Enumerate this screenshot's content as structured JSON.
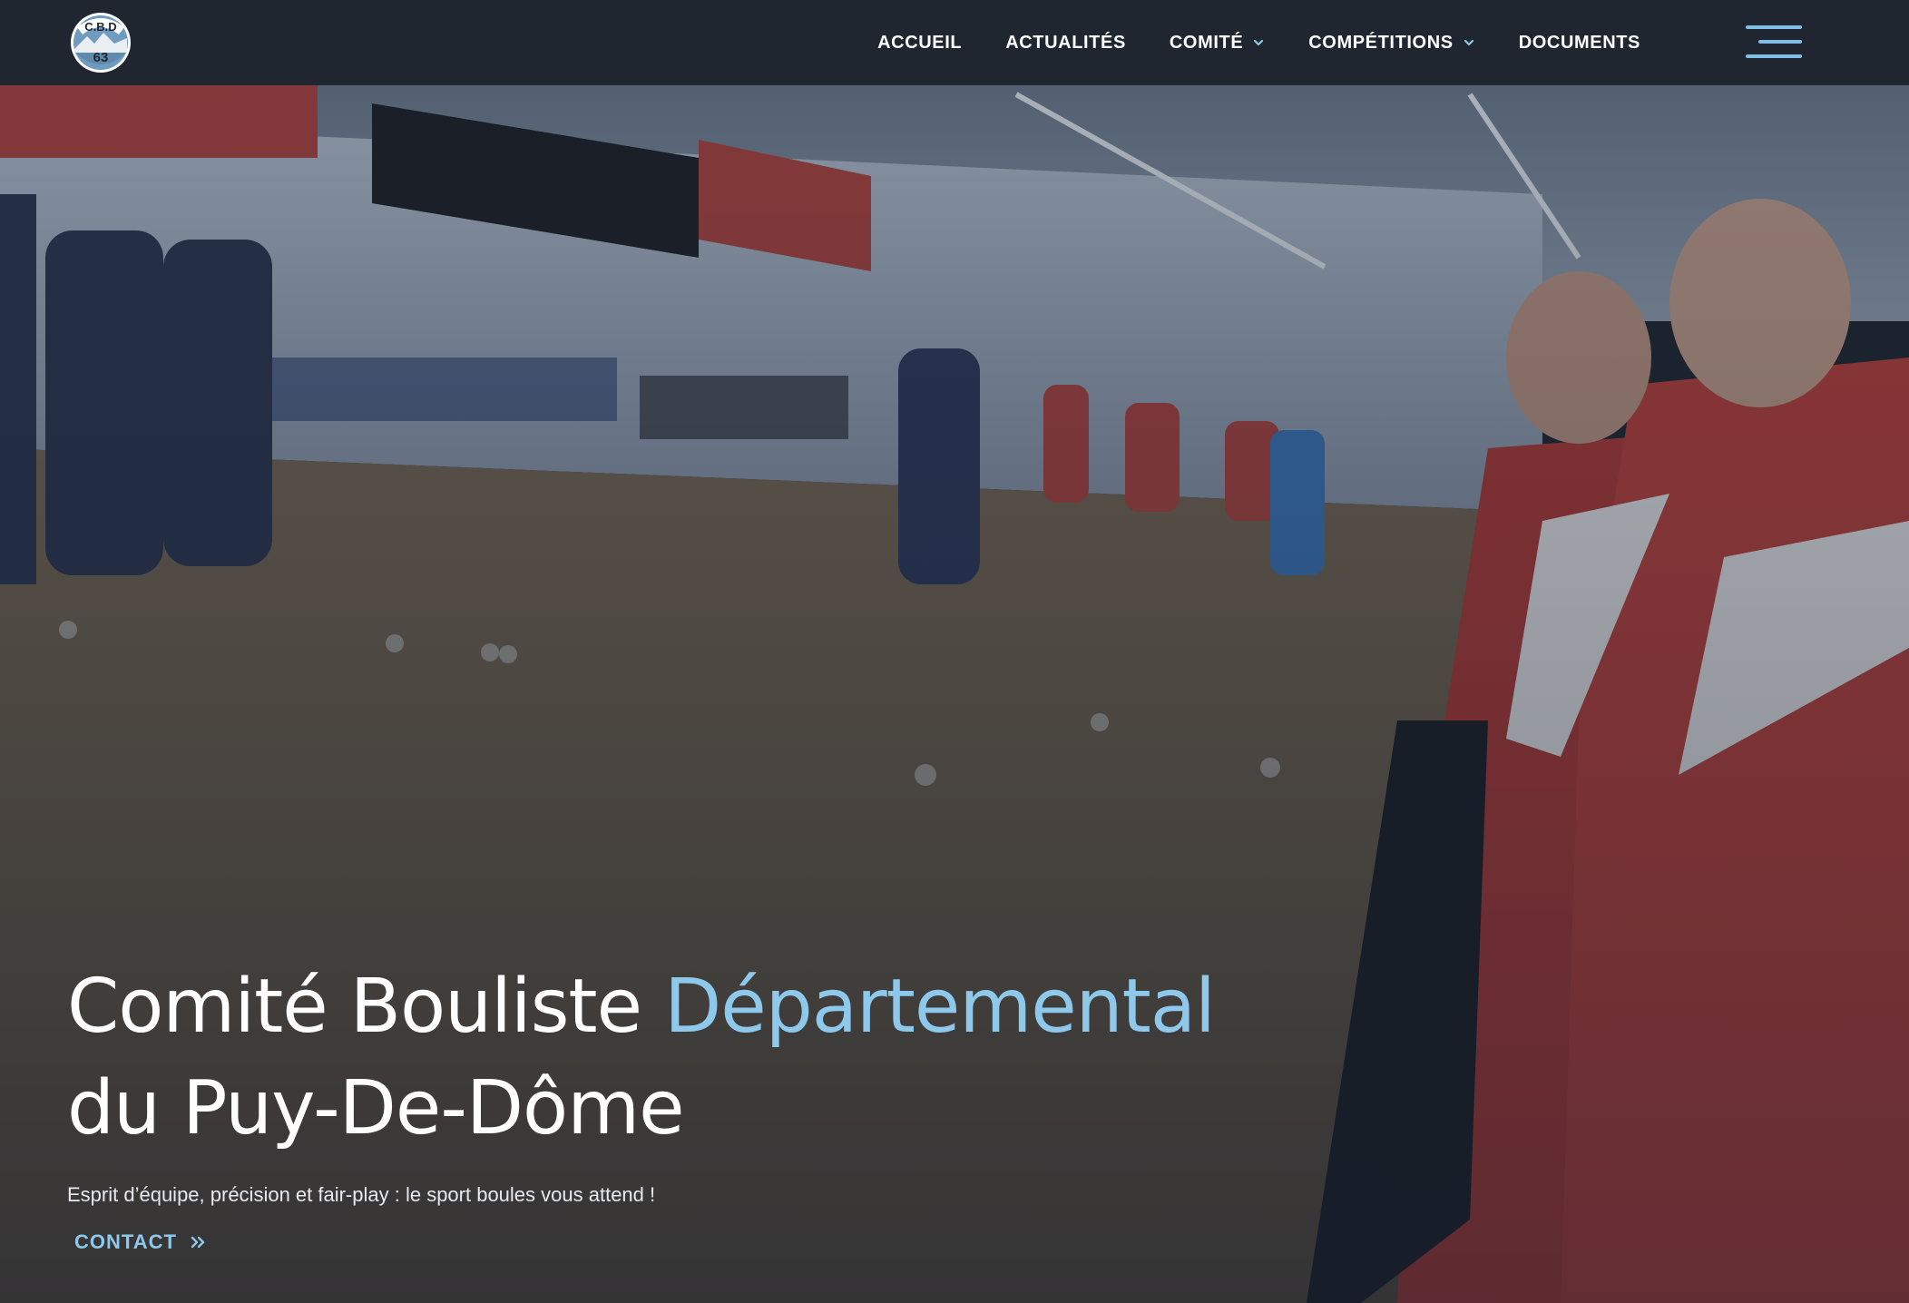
{
  "logo": {
    "line1": "C.B.D",
    "line2": "63"
  },
  "nav": {
    "items": [
      {
        "label": "ACCUEIL",
        "dropdown": false
      },
      {
        "label": "ACTUALITÉS",
        "dropdown": false
      },
      {
        "label": "COMITÉ",
        "dropdown": true
      },
      {
        "label": "COMPÉTITIONS",
        "dropdown": true
      },
      {
        "label": "DOCUMENTS",
        "dropdown": false
      }
    ],
    "menu_icon": "hamburger-menu-icon"
  },
  "hero": {
    "title_part1": "Comité Bouliste ",
    "title_accent": "Départemental",
    "title_part2": "du Puy-De-Dôme",
    "subtitle": "Esprit d’équipe, précision et fair-play : le sport boules vous attend !",
    "cta_label": "CONTACT",
    "cta_icon": "double-chevron-right-icon"
  },
  "colors": {
    "header_bg": "#1f2630",
    "accent": "#8ec8ea",
    "nav_text": "#ffffff"
  }
}
